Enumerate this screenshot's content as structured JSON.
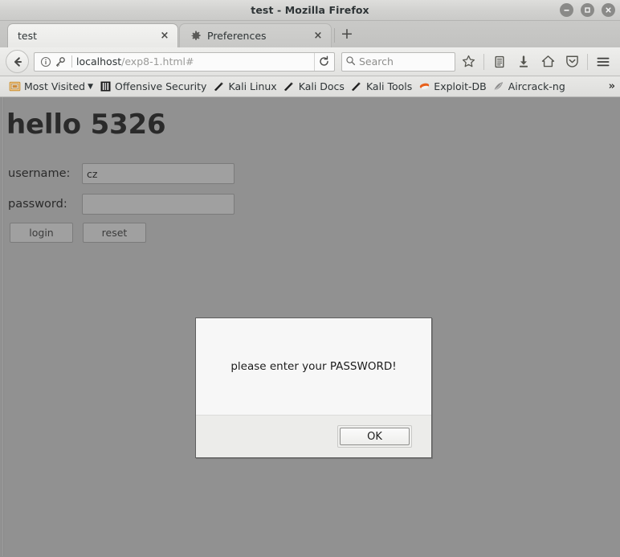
{
  "window": {
    "title": "test - Mozilla Firefox",
    "controls": [
      {
        "name": "minimize-button",
        "glyph": "minimize-icon"
      },
      {
        "name": "maximize-button",
        "glyph": "maximize-icon"
      },
      {
        "name": "close-button",
        "glyph": "close-icon"
      }
    ]
  },
  "tabs": [
    {
      "label": "test",
      "active": true,
      "favicon": "",
      "close_label": "×"
    },
    {
      "label": "Preferences",
      "active": false,
      "favicon": "gear-icon",
      "close_label": "×"
    }
  ],
  "newtab_label": "+",
  "toolbar": {
    "back_icon": "back-arrow-icon",
    "identity_icon": "info-icon",
    "key_icon": "key-icon",
    "url_host": "localhost",
    "url_path": "/exp8-1.html#",
    "url_full": "localhost/exp8-1.html#",
    "reload_icon": "reload-icon",
    "search_placeholder": "Search",
    "search_icon": "search-icon",
    "buttons": [
      {
        "name": "bookmark-star-button",
        "icon": "star-icon"
      },
      {
        "name": "library-button",
        "icon": "library-icon"
      },
      {
        "name": "downloads-button",
        "icon": "download-arrow-icon"
      },
      {
        "name": "home-button",
        "icon": "home-icon"
      },
      {
        "name": "pocket-button",
        "icon": "shield-icon"
      },
      {
        "name": "menu-button",
        "icon": "hamburger-icon"
      }
    ]
  },
  "bookmarks": {
    "items": [
      {
        "label": "Most Visited",
        "icon": "most-visited-icon",
        "has_chevron": true,
        "color": "#e8a33d"
      },
      {
        "label": "Offensive Security",
        "icon": "offensive-security-icon",
        "has_chevron": false,
        "color": "#2b2b2b"
      },
      {
        "label": "Kali Linux",
        "icon": "kali-dragon-icon",
        "has_chevron": false,
        "color": "#1f1f1f"
      },
      {
        "label": "Kali Docs",
        "icon": "kali-dragon-icon",
        "has_chevron": false,
        "color": "#1f1f1f"
      },
      {
        "label": "Kali Tools",
        "icon": "kali-dragon-icon",
        "has_chevron": false,
        "color": "#1f1f1f"
      },
      {
        "label": "Exploit-DB",
        "icon": "exploit-db-icon",
        "has_chevron": false,
        "color": "#e8601c"
      },
      {
        "label": "Aircrack-ng",
        "icon": "aircrack-icon",
        "has_chevron": false,
        "color": "#8c8c8c"
      }
    ],
    "overflow_label": "»"
  },
  "page": {
    "heading": "hello 5326",
    "background_color": "#919191",
    "fields": [
      {
        "label": "username:",
        "value": "cz",
        "placeholder": "",
        "type": "text",
        "name": "username-input"
      },
      {
        "label": "password:",
        "value": "",
        "placeholder": "",
        "type": "password",
        "name": "password-input"
      }
    ],
    "buttons": [
      {
        "label": "login",
        "name": "login-button"
      },
      {
        "label": "reset",
        "name": "reset-button"
      }
    ]
  },
  "dialog": {
    "message": "please enter your PASSWORD!",
    "ok_label": "OK"
  }
}
